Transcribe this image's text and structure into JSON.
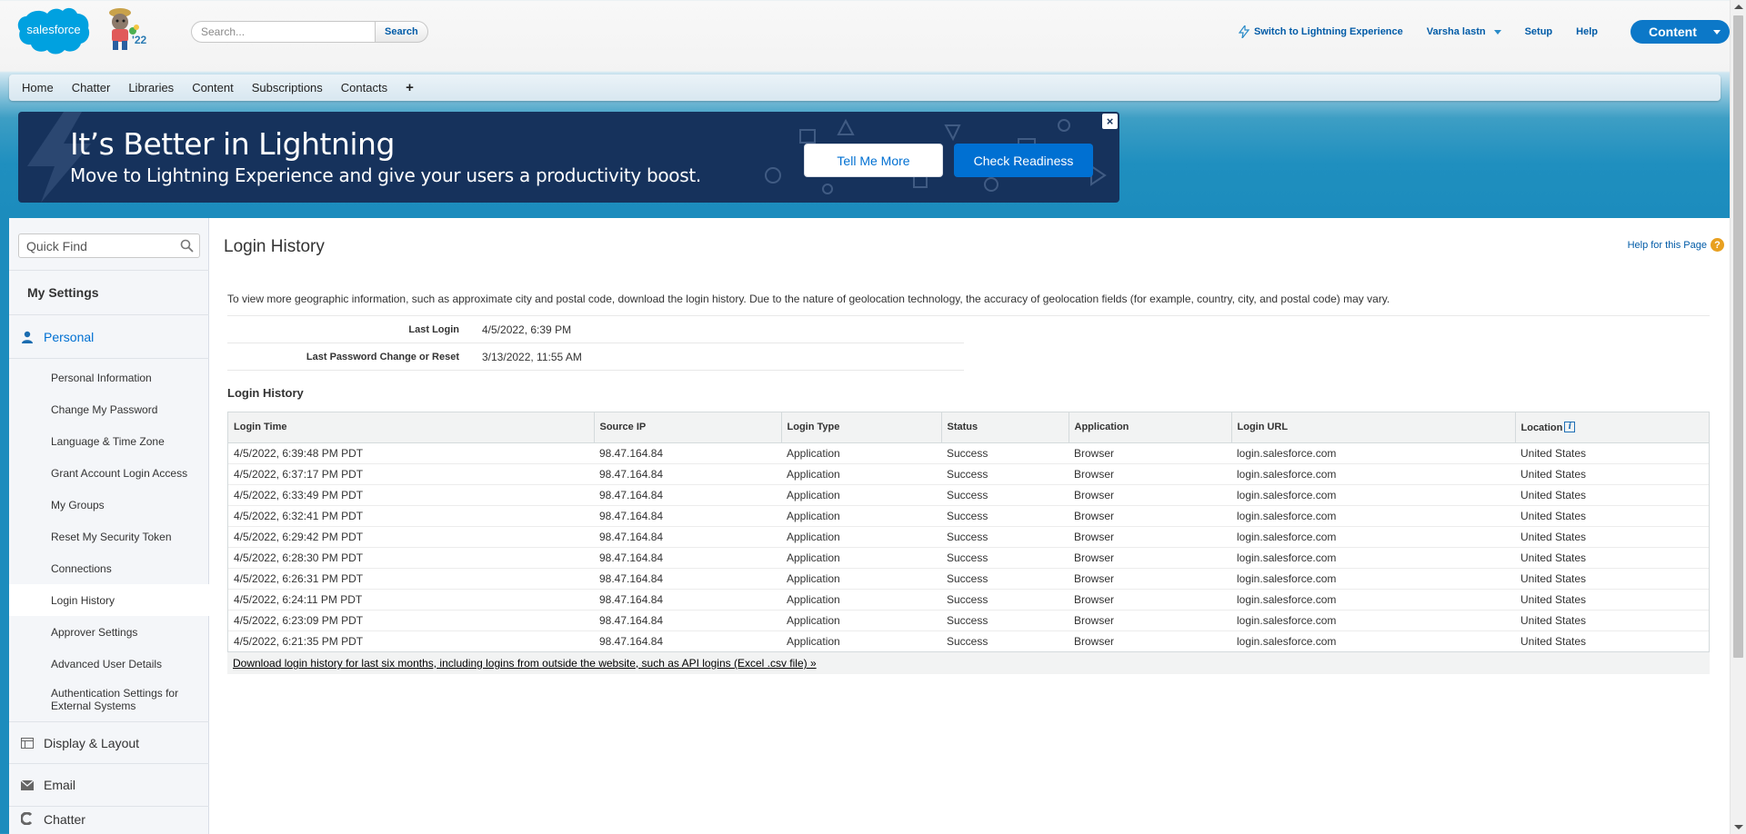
{
  "header": {
    "logo_text": "salesforce",
    "year_badge": "'22",
    "search": {
      "placeholder": "Search...",
      "button_label": "Search"
    },
    "links": {
      "lightning": "Switch to Lightning Experience",
      "user": "Varsha lastn",
      "setup": "Setup",
      "help": "Help"
    },
    "app_menu_label": "Content"
  },
  "tabs": [
    "Home",
    "Chatter",
    "Libraries",
    "Content",
    "Subscriptions",
    "Contacts"
  ],
  "tab_plus": "+",
  "banner": {
    "title": "It’s Better in Lightning",
    "subtitle": "Move to Lightning Experience and give your users a productivity boost.",
    "tell_me_more": "Tell Me More",
    "check_readiness": "Check Readiness",
    "close": "×"
  },
  "sidebar": {
    "quick_find_placeholder": "Quick Find",
    "title": "My Settings",
    "personal_label": "Personal",
    "personal_items": [
      "Personal Information",
      "Change My Password",
      "Language & Time Zone",
      "Grant Account Login Access",
      "My Groups",
      "Reset My Security Token",
      "Connections",
      "Login History",
      "Approver Settings",
      "Advanced User Details",
      "Authentication Settings for External Systems"
    ],
    "active_item": "Login History",
    "sections": [
      "Display & Layout",
      "Email",
      "Chatter"
    ]
  },
  "page": {
    "title": "Login History",
    "help_link": "Help for this Page",
    "help_icon": "?",
    "description": "To view more geographic information, such as approximate city and postal code, download the login history. Due to the nature of geolocation technology, the accuracy of geolocation fields (for example, country, city, and postal code) may vary.",
    "details": {
      "last_login_label": "Last Login",
      "last_login_value": "4/5/2022, 6:39 PM",
      "last_password_label": "Last Password Change or Reset",
      "last_password_value": "3/13/2022, 11:55 AM"
    },
    "section_title": "Login History",
    "table": {
      "columns": [
        "Login Time",
        "Source IP",
        "Login Type",
        "Status",
        "Application",
        "Login URL",
        "Location"
      ],
      "info_icon": "i",
      "rows": [
        [
          "4/5/2022, 6:39:48 PM PDT",
          "98.47.164.84",
          "Application",
          "Success",
          "Browser",
          "login.salesforce.com",
          "United States"
        ],
        [
          "4/5/2022, 6:37:17 PM PDT",
          "98.47.164.84",
          "Application",
          "Success",
          "Browser",
          "login.salesforce.com",
          "United States"
        ],
        [
          "4/5/2022, 6:33:49 PM PDT",
          "98.47.164.84",
          "Application",
          "Success",
          "Browser",
          "login.salesforce.com",
          "United States"
        ],
        [
          "4/5/2022, 6:32:41 PM PDT",
          "98.47.164.84",
          "Application",
          "Success",
          "Browser",
          "login.salesforce.com",
          "United States"
        ],
        [
          "4/5/2022, 6:29:42 PM PDT",
          "98.47.164.84",
          "Application",
          "Success",
          "Browser",
          "login.salesforce.com",
          "United States"
        ],
        [
          "4/5/2022, 6:28:30 PM PDT",
          "98.47.164.84",
          "Application",
          "Success",
          "Browser",
          "login.salesforce.com",
          "United States"
        ],
        [
          "4/5/2022, 6:26:31 PM PDT",
          "98.47.164.84",
          "Application",
          "Success",
          "Browser",
          "login.salesforce.com",
          "United States"
        ],
        [
          "4/5/2022, 6:24:11 PM PDT",
          "98.47.164.84",
          "Application",
          "Success",
          "Browser",
          "login.salesforce.com",
          "United States"
        ],
        [
          "4/5/2022, 6:23:09 PM PDT",
          "98.47.164.84",
          "Application",
          "Success",
          "Browser",
          "login.salesforce.com",
          "United States"
        ],
        [
          "4/5/2022, 6:21:35 PM PDT",
          "98.47.164.84",
          "Application",
          "Success",
          "Browser",
          "login.salesforce.com",
          "United States"
        ]
      ]
    },
    "download_link": "Download login history for last six months, including logins from outside the website, such as API logins (Excel .csv file) »"
  },
  "colors": {
    "brand_blue": "#00a1e0",
    "link_blue": "#015ba7",
    "banner_navy": "#16325c",
    "button_blue": "#0070d2"
  },
  "icons": {
    "lightning": "bolt-icon",
    "user_menu": "caret-down-icon",
    "quick_find": "search-icon",
    "personal": "user-icon",
    "display_layout": "layout-icon",
    "email": "email-icon",
    "chatter": "chatter-icon"
  }
}
